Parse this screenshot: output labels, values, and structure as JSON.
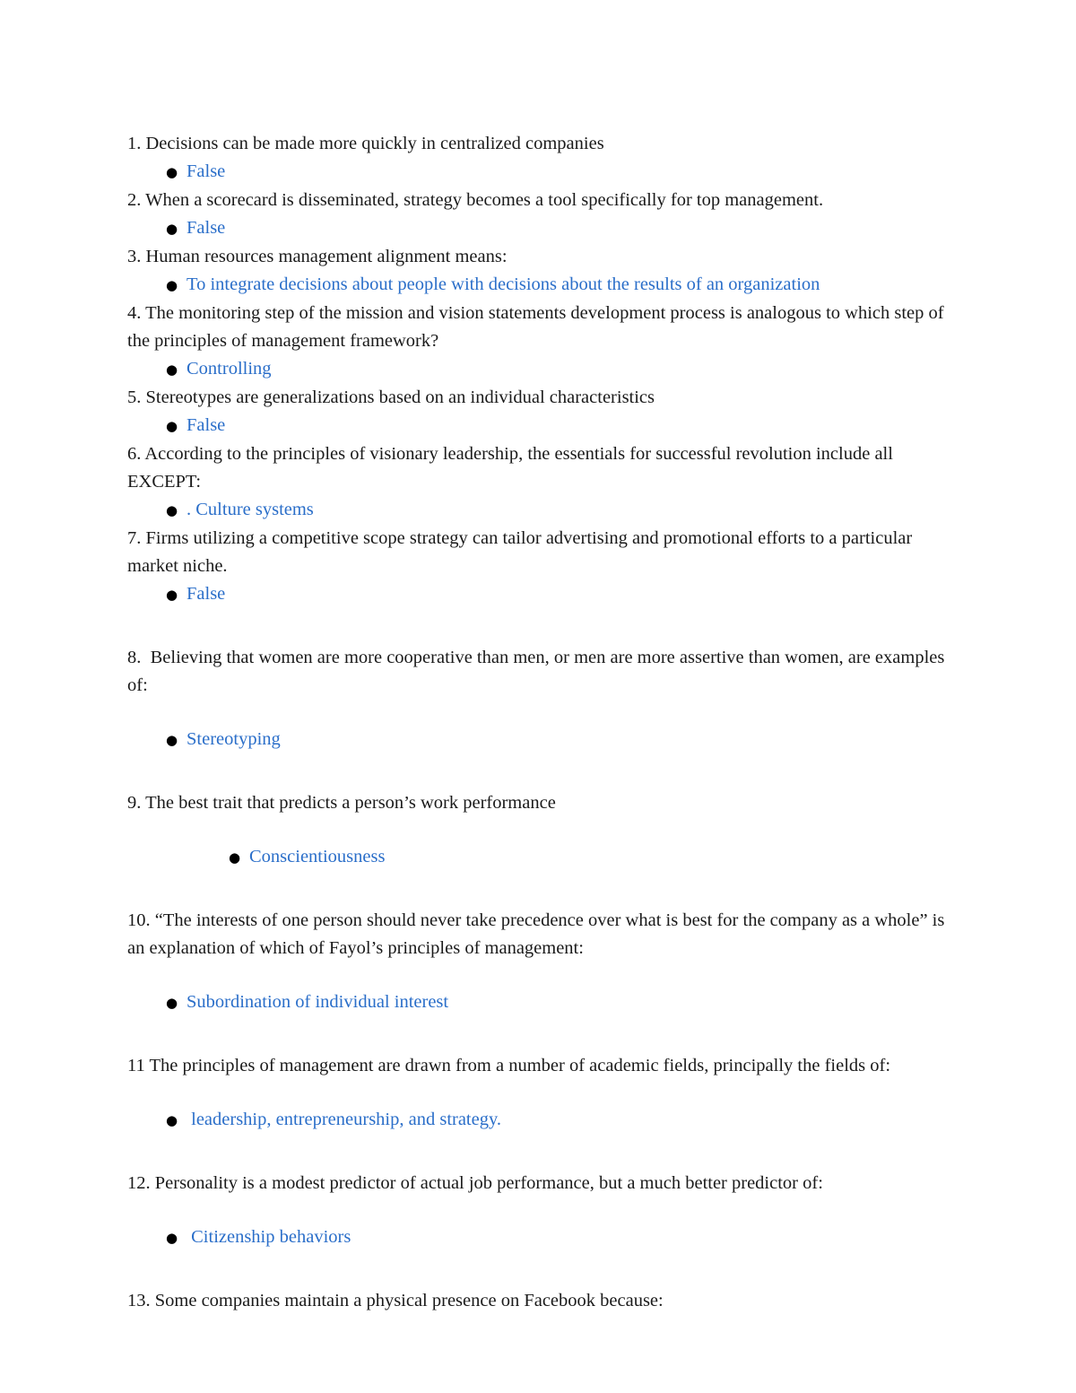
{
  "document": {
    "bullet_glyph": "●",
    "answer_color": "#2a6ec9",
    "text_color": "#1a1a1a",
    "background": "#ffffff"
  },
  "items": [
    {
      "number": "1.",
      "question": "1. Decisions can be made more quickly in centralized companies",
      "answer": "False"
    },
    {
      "number": "2.",
      "question": "2. When a scorecard is disseminated, strategy becomes a tool specifically for top management.",
      "answer": "False"
    },
    {
      "number": "3.",
      "question": "3. Human resources management alignment means:",
      "answer": "To integrate decisions about people with decisions about the results of an organization"
    },
    {
      "number": "4.",
      "question": "4. The monitoring step of the mission and vision statements development process is analogous to which step of the principles of management framework?",
      "answer": "Controlling"
    },
    {
      "number": "5.",
      "question": "5. Stereotypes are generalizations based on an individual characteristics",
      "answer": "False"
    },
    {
      "number": "6.",
      "question": "6. According to the principles of visionary leadership, the essentials for successful revolution include all EXCEPT:",
      "answer": ". Culture systems"
    },
    {
      "number": "7.",
      "question": "7. Firms utilizing a competitive scope strategy can tailor advertising and promotional efforts to a particular market niche.",
      "answer": "False"
    },
    {
      "number": "8.",
      "question": "8.  Believing that women are more cooperative than men, or men are more assertive than women, are examples of:",
      "answer": "Stereotyping"
    },
    {
      "number": "9.",
      "question": "9. The best trait that predicts a person’s work performance",
      "answer": "Conscientiousness"
    },
    {
      "number": "10.",
      "question": "10. “The interests of one person should never take precedence over what is best for the company as a whole” is an explanation of which of Fayol’s principles of management:",
      "answer": "Subordination of individual interest"
    },
    {
      "number": "11",
      "question": "11 The principles of management are drawn from a number of academic fields, principally the fields of:",
      "answer": " leadership, entrepreneurship, and strategy."
    },
    {
      "number": "12.",
      "question": "12. Personality is a modest predictor of actual job performance, but a much better predictor of:",
      "answer": " Citizenship behaviors"
    },
    {
      "number": "13.",
      "question": "13. Some companies maintain a physical presence on Facebook because:",
      "answer": null
    }
  ]
}
